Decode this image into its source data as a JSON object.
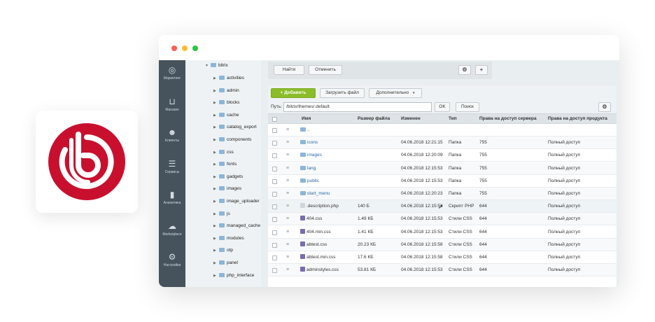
{
  "leftmenu": [
    {
      "icon": "target-icon",
      "label": "Маркетинг"
    },
    {
      "icon": "basket-icon",
      "label": "Магазин"
    },
    {
      "icon": "crm-icon",
      "label": "Клиенты"
    },
    {
      "icon": "layers-icon",
      "label": "Сервисы"
    },
    {
      "icon": "bar-chart-icon",
      "label": "Аналитика"
    },
    {
      "icon": "cloud-download-icon",
      "label": "Marketplace"
    },
    {
      "icon": "gear-icon",
      "label": "Настройки"
    }
  ],
  "tree": {
    "root": "bitrix",
    "items": [
      "activities",
      "admin",
      "blocks",
      "cache",
      "catalog_export",
      "components",
      "css",
      "fonts",
      "gadgets",
      "images",
      "image_uploader",
      "js",
      "managed_cache",
      "modules",
      "otp",
      "panel",
      "php_interface"
    ]
  },
  "filter": {
    "find_label": "Найти",
    "cancel_label": "Отменить",
    "settings_icon": "gear-icon",
    "add_icon": "+"
  },
  "toolbar": {
    "add_label": "Добавить",
    "upload_label": "Загрузить файл",
    "more_label": "Дополнительно"
  },
  "path": {
    "label": "Путь:",
    "value": "/bitrix/themes/.default",
    "ok_label": "OK",
    "search_label": "Поиск"
  },
  "table": {
    "headers": [
      "Имя",
      "Размер файла",
      "Изменен",
      "Тип",
      "Права на доступ сервера",
      "Права на доступ продукта"
    ],
    "rows": [
      {
        "kind": "up",
        "name": "..",
        "size": "",
        "modified": "",
        "type": "",
        "server": "",
        "product": ""
      },
      {
        "kind": "folder",
        "name": "icons",
        "size": "",
        "modified": "04.06.2018 12:21:15",
        "type": "Папка",
        "server": "755",
        "product": "Полный доступ"
      },
      {
        "kind": "folder",
        "name": "images",
        "size": "",
        "modified": "04.06.2018 12:20:09",
        "type": "Папка",
        "server": "755",
        "product": "Полный доступ"
      },
      {
        "kind": "folder",
        "name": "lang",
        "size": "",
        "modified": "04.06.2018 12:15:53",
        "type": "Папка",
        "server": "755",
        "product": "Полный доступ"
      },
      {
        "kind": "folder",
        "name": "public",
        "size": "",
        "modified": "04.06.2018 12:15:53",
        "type": "Папка",
        "server": "755",
        "product": "Полный доступ"
      },
      {
        "kind": "folder",
        "name": "start_menu",
        "size": "",
        "modified": "04.06.2018 12:20:23",
        "type": "Папка",
        "server": "755",
        "product": "Полный доступ"
      },
      {
        "kind": "file",
        "name": ".description.php",
        "size": "140 Б",
        "modified": "04.06.2018 12:15:53",
        "type": "Скрипт PHP",
        "server": "644",
        "product": "Полный доступ"
      },
      {
        "kind": "css",
        "name": "404.css",
        "size": "1.49 КБ",
        "modified": "04.06.2018 12:15:53",
        "type": "Стили CSS",
        "server": "644",
        "product": "Полный доступ"
      },
      {
        "kind": "css",
        "name": "404.min.css",
        "size": "1.41 КБ",
        "modified": "04.06.2018 12:15:53",
        "type": "Стили CSS",
        "server": "644",
        "product": "Полный доступ"
      },
      {
        "kind": "css",
        "name": "abtest.css",
        "size": "20.23 КБ",
        "modified": "04.06.2018 12:15:58",
        "type": "Стили CSS",
        "server": "644",
        "product": "Полный доступ"
      },
      {
        "kind": "css",
        "name": "abtest.min.css",
        "size": "17.6 КБ",
        "modified": "04.06.2018 12:15:58",
        "type": "Стили CSS",
        "server": "644",
        "product": "Полный доступ"
      },
      {
        "kind": "css",
        "name": "adminstyles.css",
        "size": "53.81 КБ",
        "modified": "04.06.2018 12:15:53",
        "type": "Стили CSS",
        "server": "644",
        "product": "Полный доступ"
      }
    ]
  },
  "colors": {
    "brand": "#c8102e",
    "accent_green": "#8bbd2a",
    "menu_bg": "#46525c"
  }
}
